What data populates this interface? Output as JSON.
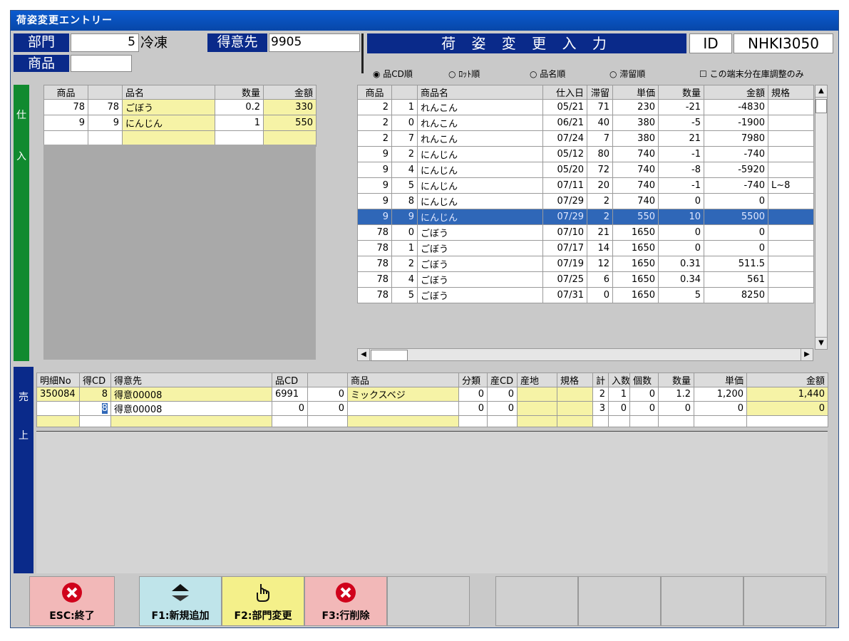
{
  "window": {
    "title": "荷姿変更エントリー"
  },
  "header": {
    "dept_label": "部門",
    "dept_value": "5",
    "dept_name": "冷凍",
    "customer_label": "得意先",
    "customer_value": "9905",
    "product_label": "商品",
    "banner": "荷 姿 変 更 入 力",
    "id_label": "ID",
    "id_value": "NHKI3050"
  },
  "sort_options": {
    "opt1": "品CD順",
    "opt2": "ﾛｯﾄ順",
    "opt3": "品名順",
    "opt4": "滞留順",
    "checkbox": "この端末分在庫調整のみ"
  },
  "purchase": {
    "side_label_1": "仕",
    "side_label_2": "入",
    "headers": [
      "商品",
      "",
      "品名",
      "数量",
      "金額"
    ],
    "rows": [
      [
        "78",
        "78",
        "ごぼう",
        "0.2",
        "330"
      ],
      [
        "9",
        "9",
        "にんじん",
        "1",
        "550"
      ],
      [
        "",
        "",
        "",
        "",
        ""
      ]
    ]
  },
  "stock": {
    "headers": [
      "商品",
      "",
      "商品名",
      "仕入日",
      "滞留",
      "単価",
      "数量",
      "金額",
      "規格"
    ],
    "rows": [
      [
        "2",
        "1",
        "れんこん",
        "05/21",
        "71",
        "230",
        "-21",
        "-4830",
        ""
      ],
      [
        "2",
        "0",
        "れんこん",
        "06/21",
        "40",
        "380",
        "-5",
        "-1900",
        ""
      ],
      [
        "2",
        "7",
        "れんこん",
        "07/24",
        "7",
        "380",
        "21",
        "7980",
        ""
      ],
      [
        "9",
        "2",
        "にんじん",
        "05/12",
        "80",
        "740",
        "-1",
        "-740",
        ""
      ],
      [
        "9",
        "4",
        "にんじん",
        "05/20",
        "72",
        "740",
        "-8",
        "-5920",
        ""
      ],
      [
        "9",
        "5",
        "にんじん",
        "07/11",
        "20",
        "740",
        "-1",
        "-740",
        "L~8"
      ],
      [
        "9",
        "8",
        "にんじん",
        "07/29",
        "2",
        "740",
        "0",
        "0",
        ""
      ],
      [
        "9",
        "9",
        "にんじん",
        "07/29",
        "2",
        "550",
        "10",
        "5500",
        ""
      ],
      [
        "78",
        "0",
        "ごぼう",
        "07/10",
        "21",
        "1650",
        "0",
        "0",
        ""
      ],
      [
        "78",
        "1",
        "ごぼう",
        "07/17",
        "14",
        "1650",
        "0",
        "0",
        ""
      ],
      [
        "78",
        "2",
        "ごぼう",
        "07/19",
        "12",
        "1650",
        "0.31",
        "511.5",
        ""
      ],
      [
        "78",
        "4",
        "ごぼう",
        "07/25",
        "6",
        "1650",
        "0.34",
        "561",
        ""
      ],
      [
        "78",
        "5",
        "ごぼう",
        "07/31",
        "0",
        "1650",
        "5",
        "8250",
        ""
      ]
    ]
  },
  "sales": {
    "side_label_1": "売",
    "side_label_2": "上",
    "headers": [
      "明細No",
      "得CD",
      "得意先",
      "品CD",
      "",
      "商品",
      "分類",
      "産CD",
      "産地",
      "規格",
      "計",
      "入数",
      "個数",
      "数量",
      "単価",
      "金額"
    ],
    "rows": [
      [
        "350084",
        "8",
        "得意00008",
        "6991",
        "0",
        "ミックスベジ",
        "0",
        "0",
        "",
        "",
        "2",
        "1",
        "0",
        "1.2",
        "1,200",
        "1,440"
      ],
      [
        "",
        "8",
        "得意00008",
        "0",
        "0",
        "",
        "0",
        "0",
        "",
        "",
        "3",
        "0",
        "0",
        "0",
        "0",
        "0"
      ],
      [
        "",
        "",
        "",
        "",
        "",
        "",
        "",
        "",
        "",
        "",
        "",
        "",
        "",
        "",
        "",
        ""
      ]
    ]
  },
  "footer": {
    "esc_label": "ESC:終了",
    "f1_label": "F1:新規追加",
    "f2_label": "F2:部門変更",
    "f3_label": "F3:行削除"
  }
}
